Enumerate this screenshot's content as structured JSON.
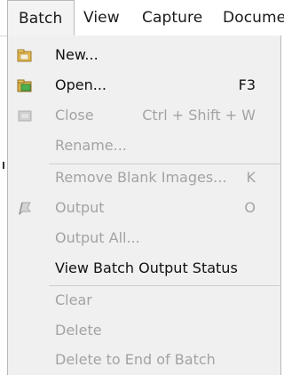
{
  "menubar": {
    "items": [
      {
        "label": "Batch",
        "active": true
      },
      {
        "label": "View",
        "active": false
      },
      {
        "label": "Capture",
        "active": false
      },
      {
        "label": "Docume",
        "active": false
      }
    ]
  },
  "batch_menu": {
    "items": [
      {
        "label": "New...",
        "shortcut": "",
        "enabled": true,
        "icon": "new-batch-icon"
      },
      {
        "label": "Open...",
        "shortcut": "F3",
        "enabled": true,
        "icon": "open-batch-icon"
      },
      {
        "label": "Close",
        "shortcut": "Ctrl + Shift + W",
        "enabled": false,
        "icon": "close-batch-icon"
      },
      {
        "label": "Rename...",
        "shortcut": "",
        "enabled": false,
        "icon": ""
      },
      {
        "label": "Remove Blank Images...",
        "shortcut": "K",
        "enabled": false,
        "icon": ""
      },
      {
        "label": "Output",
        "shortcut": "O",
        "enabled": false,
        "icon": "output-icon"
      },
      {
        "label": "Output All...",
        "shortcut": "",
        "enabled": false,
        "icon": ""
      },
      {
        "label": "View Batch Output Status",
        "shortcut": "",
        "enabled": true,
        "icon": ""
      },
      {
        "label": "Clear",
        "shortcut": "",
        "enabled": false,
        "icon": ""
      },
      {
        "label": "Delete",
        "shortcut": "",
        "enabled": false,
        "icon": ""
      },
      {
        "label": "Delete to End of Batch",
        "shortcut": "",
        "enabled": false,
        "icon": ""
      }
    ]
  }
}
